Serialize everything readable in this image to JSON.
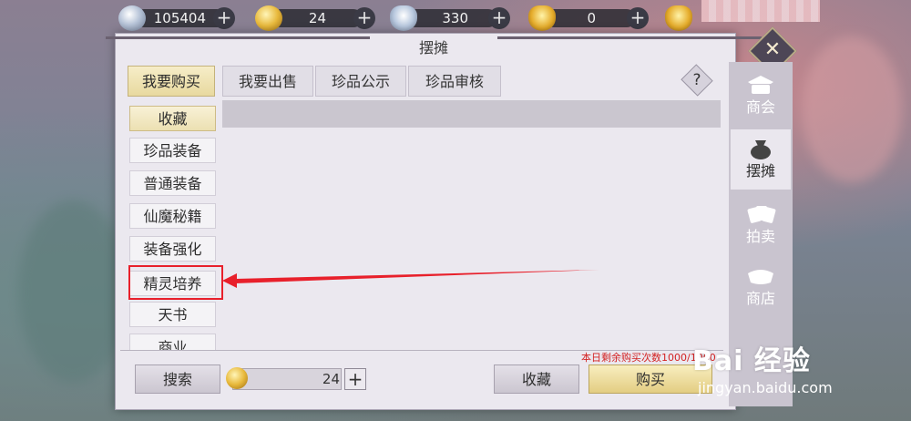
{
  "currency": {
    "silver_coin": "105404",
    "gold_coin": "24",
    "silver_ingot": "330",
    "gold_ingot": "0",
    "add_symbol": "+"
  },
  "window": {
    "title": "摆摊",
    "close_symbol": "✕"
  },
  "tabs": [
    "我要购买",
    "我要出售",
    "珍品公示",
    "珍品审核"
  ],
  "help_symbol": "?",
  "categories": [
    "收藏",
    "珍品装备",
    "普通装备",
    "仙魔秘籍",
    "装备强化",
    "精灵培养",
    "天书",
    "商业"
  ],
  "bottom": {
    "search_label": "搜索",
    "price_value": "24",
    "price_add_symbol": "+",
    "favorite_label": "收藏",
    "buy_label": "购买",
    "notice": "本日剩余购买次数1000/1000"
  },
  "sidenav": [
    "商会",
    "摆摊",
    "拍卖",
    "商店"
  ],
  "watermark": {
    "logo": "Bai 经验",
    "url": "jingyan.baidu.com"
  },
  "colors": {
    "annotation_red": "#e8202b",
    "notice_red": "#d32222",
    "active_tab_gold": "#e8d99f"
  }
}
